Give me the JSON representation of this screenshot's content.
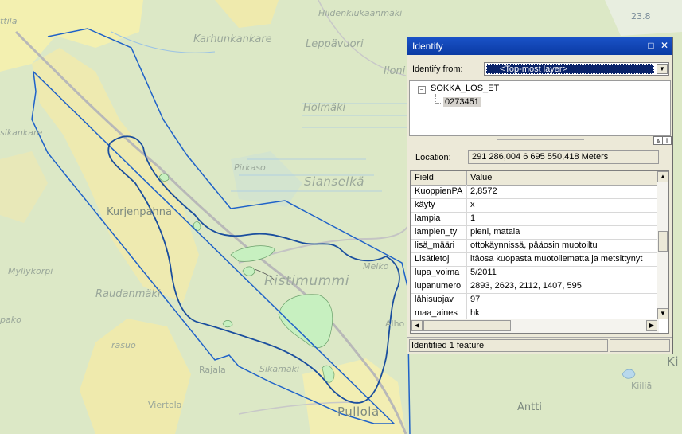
{
  "map": {
    "labels": {
      "hiidenkiukaanmaki": "Hiidenkiukaanmäki",
      "karhunkankare": "Karhunkankare",
      "leppavuori": "Leppävuori",
      "ilonie": "Iloni",
      "holmaki": "Holmäki",
      "sikankare": "sikankare",
      "pirkaso": "Pirkaso",
      "sianselka": "Sianselkä",
      "kurjenpahna": "Kurjenpahna",
      "ristimummi": "Ristimummi",
      "melkon": "Melko",
      "myllykorpi": "Myllykorpi",
      "raudanmaki": "Raudanmäki",
      "alho": "Alho",
      "pako": "pako",
      "rasuo": "rasuo",
      "sikamaki": "Sikamäki",
      "rajala": "Rajala",
      "kiilia": "Kiiliä",
      "vieritola": "Viertola",
      "pullola": "Pullola",
      "antti": "Antti",
      "ki": "Ki",
      "ttila": "ttila",
      "elev": "23.8"
    }
  },
  "identify": {
    "title": "Identify",
    "maximize_icon": "□",
    "close_icon": "✕",
    "identify_from_label": "Identify from:",
    "identify_from_value": "<Top-most layer>",
    "tree": {
      "layer": "SOKKA_LOS_ET",
      "feature": "0273451"
    },
    "location_label": "Location:",
    "location_value": "291 286,004  6 695 550,418 Meters",
    "grid_headers": {
      "field": "Field",
      "value": "Value"
    },
    "rows": [
      {
        "field": "KuoppienPA",
        "value": "2,8572"
      },
      {
        "field": "käyty",
        "value": "x"
      },
      {
        "field": "lampia",
        "value": "1"
      },
      {
        "field": "lampien_ty",
        "value": "pieni, matala"
      },
      {
        "field": "lisä_määri",
        "value": "ottokäynnissä, pääosin muotoiltu"
      },
      {
        "field": "Lisätietoj",
        "value": "itäosa kuopasta muotoilematta ja metsittynyt"
      },
      {
        "field": "lupa_voima",
        "value": "5/2011"
      },
      {
        "field": "lupanumero",
        "value": "2893, 2623, 2112, 1407, 595"
      },
      {
        "field": "lähisuojav",
        "value": "97"
      },
      {
        "field": "maa_aines",
        "value": "hk"
      }
    ],
    "status": "Identified 1 feature"
  }
}
